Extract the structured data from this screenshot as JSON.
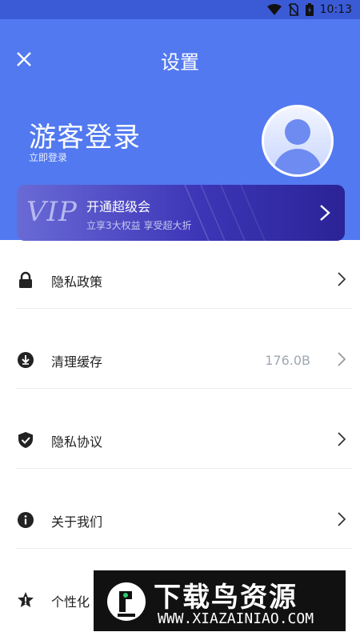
{
  "status_bar": {
    "time": "10:13"
  },
  "header": {
    "title": "设置",
    "guest_title": "游客登录",
    "guest_subtitle": "立即登录"
  },
  "vip_banner": {
    "badge": "VIP",
    "title": "开通超级会",
    "subtitle": "立享3大权益  享受超大折"
  },
  "menu": {
    "items": [
      {
        "label": "隐私政策",
        "icon": "lock-icon"
      },
      {
        "label": "清理缓存",
        "icon": "download-circle-icon",
        "value": "176.0B"
      },
      {
        "label": "隐私协议",
        "icon": "shield-check-icon"
      },
      {
        "label": "关于我们",
        "icon": "info-icon"
      },
      {
        "label": "个性化",
        "icon": "star-alert-icon"
      }
    ]
  },
  "watermark": {
    "title": "下载鸟资源",
    "url": "WWW.XIAZAINIAO.COM"
  },
  "colors": {
    "header_blue": "#5279f0",
    "vip_gradient_start": "#6a6ad6",
    "vip_gradient_end": "#2a2396",
    "value_gray": "#a0a8b2"
  }
}
